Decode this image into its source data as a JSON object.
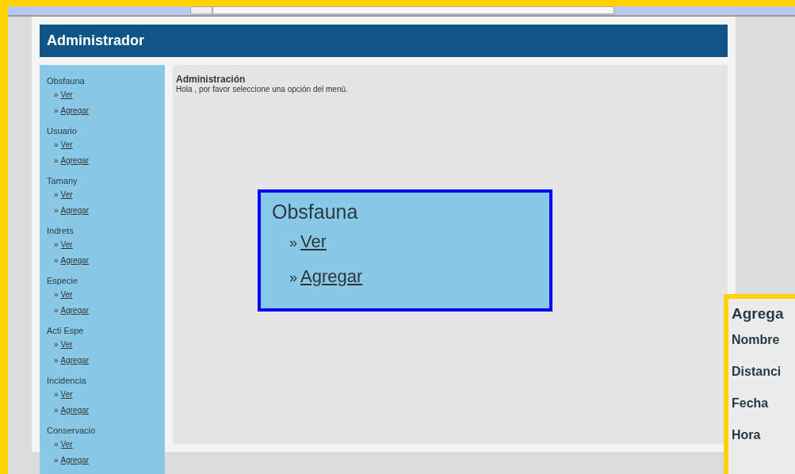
{
  "header": {
    "title": "Administrador"
  },
  "sidebar": {
    "sections": [
      {
        "title": "Obsfauna",
        "links": [
          {
            "marker": "»",
            "label": "Ver"
          },
          {
            "marker": "»",
            "label": "Agregar"
          }
        ]
      },
      {
        "title": "Usuario",
        "links": [
          {
            "marker": "»",
            "label": "Ver"
          },
          {
            "marker": "»",
            "label": "Agregar"
          }
        ]
      },
      {
        "title": "Tamany",
        "links": [
          {
            "marker": "»",
            "label": "Ver"
          },
          {
            "marker": "»",
            "label": "Agregar"
          }
        ]
      },
      {
        "title": "Indrets",
        "links": [
          {
            "marker": "»",
            "label": "Ver"
          },
          {
            "marker": "»",
            "label": "Agregar"
          }
        ]
      },
      {
        "title": "Especie",
        "links": [
          {
            "marker": "»",
            "label": "Ver"
          },
          {
            "marker": "»",
            "label": "Agregar"
          }
        ]
      },
      {
        "title": "Acti Espe",
        "links": [
          {
            "marker": "»",
            "label": "Ver"
          },
          {
            "marker": "»",
            "label": "Agregar"
          }
        ]
      },
      {
        "title": "Incidencia",
        "links": [
          {
            "marker": "»",
            "label": "Ver"
          },
          {
            "marker": "»",
            "label": "Agregar"
          }
        ]
      },
      {
        "title": "Conservacio",
        "links": [
          {
            "marker": "»",
            "label": "Ver"
          },
          {
            "marker": "»",
            "label": "Agregar"
          }
        ]
      }
    ]
  },
  "content": {
    "title": "Administración",
    "message": "Hola , por favor seleccione una opción del menú."
  },
  "zoom_inset": {
    "title": "Obsfauna",
    "links": [
      {
        "marker": "»",
        "label": "Ver"
      },
      {
        "marker": "»",
        "label": "Agregar"
      }
    ]
  },
  "form_inset": {
    "title": "Agrega",
    "labels": [
      "Nombre",
      "Distanci",
      "Fecha",
      "Hora"
    ]
  }
}
